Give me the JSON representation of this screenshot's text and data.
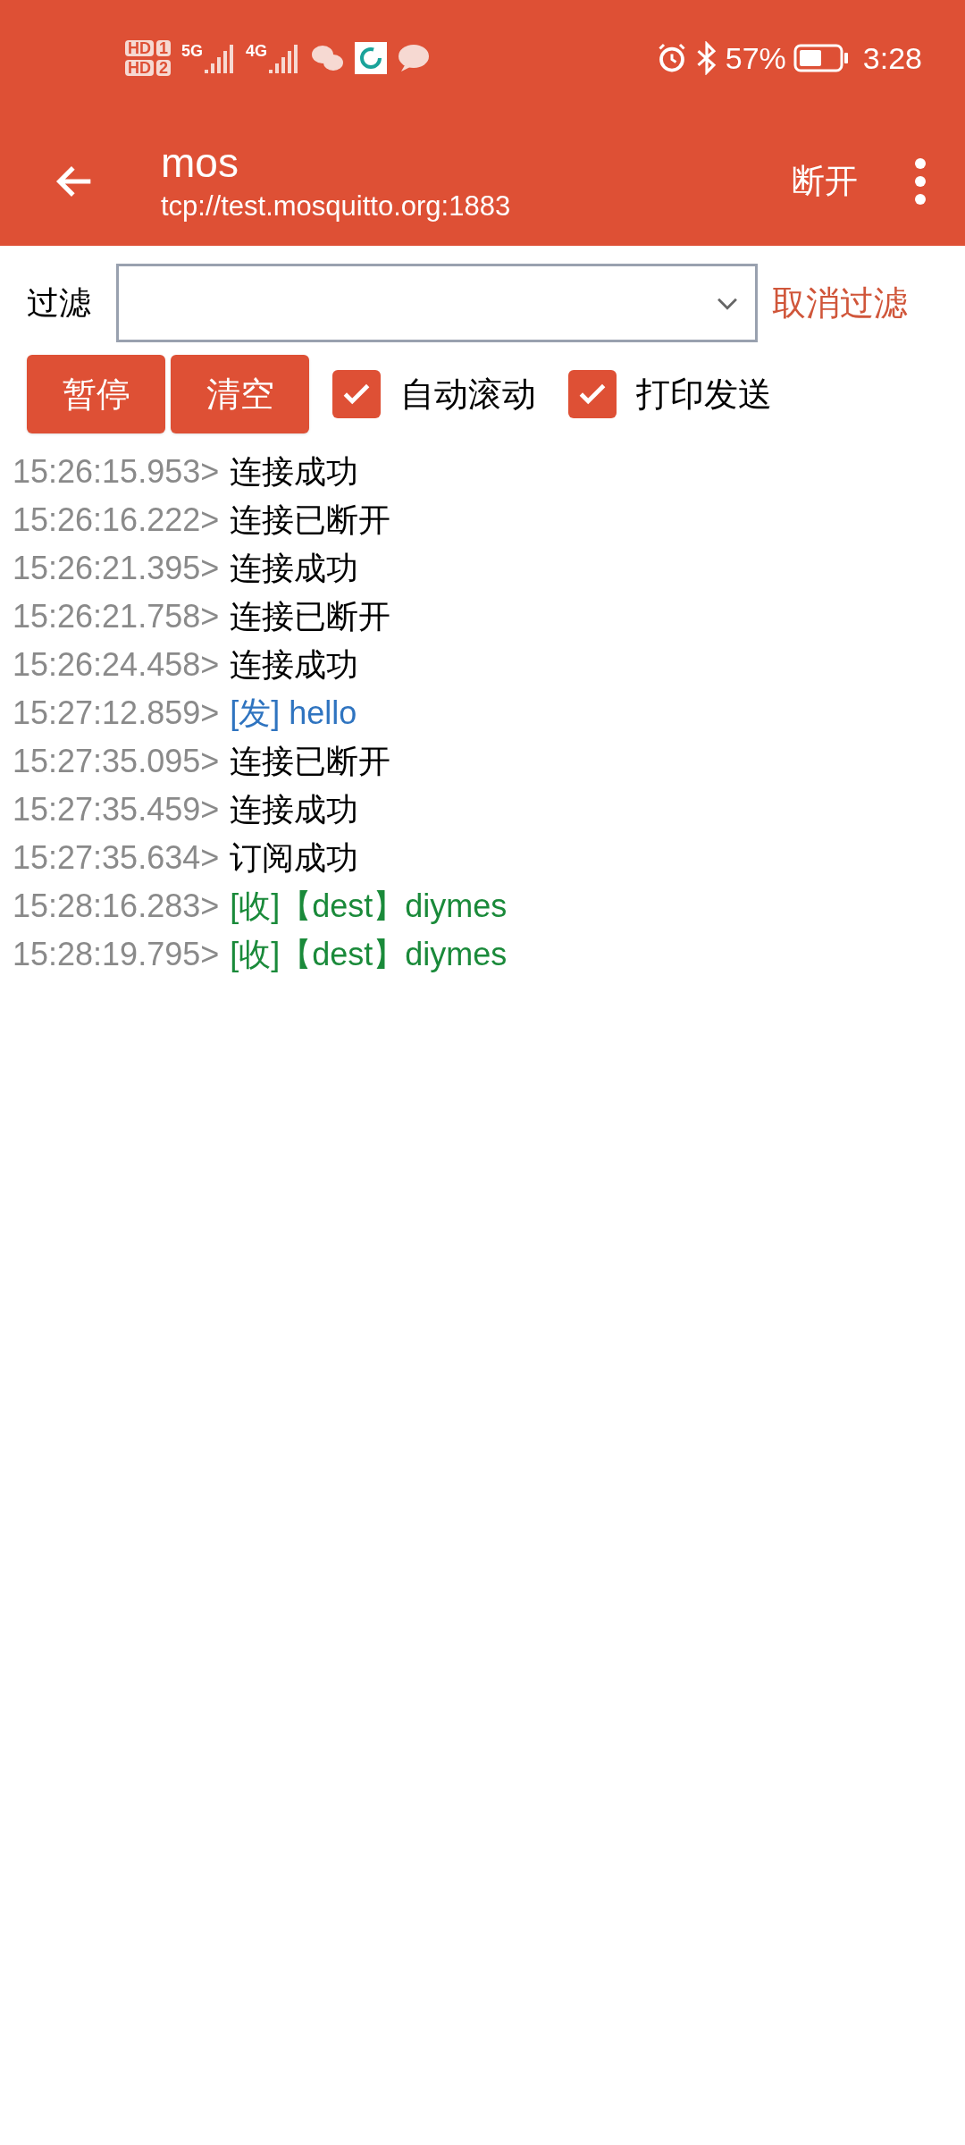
{
  "status_bar": {
    "sims": [
      {
        "hd": "HD",
        "slot": "1"
      },
      {
        "hd": "HD",
        "slot": "2"
      }
    ],
    "networks": [
      "5G",
      "4G"
    ],
    "battery": "57%",
    "time": "3:28"
  },
  "app_bar": {
    "title": "mos",
    "subtitle": "tcp://test.mosquitto.org:1883",
    "action": "断开"
  },
  "filter": {
    "label": "过滤",
    "cancel": "取消过滤"
  },
  "buttons": [
    "暂停",
    "清空"
  ],
  "checkboxes": [
    {
      "label": "自动滚动",
      "checked": true
    },
    {
      "label": "打印发送",
      "checked": true
    }
  ],
  "log": [
    {
      "time": "15:26:15.953>",
      "text": "连接成功",
      "kind": "info"
    },
    {
      "time": "15:26:16.222>",
      "text": "连接已断开",
      "kind": "info"
    },
    {
      "time": "15:26:21.395>",
      "text": "连接成功",
      "kind": "info"
    },
    {
      "time": "15:26:21.758>",
      "text": "连接已断开",
      "kind": "info"
    },
    {
      "time": "15:26:24.458>",
      "text": "连接成功",
      "kind": "info"
    },
    {
      "time": "15:27:12.859>",
      "text": "[发] hello",
      "kind": "sent"
    },
    {
      "time": "15:27:35.095>",
      "text": "连接已断开",
      "kind": "info"
    },
    {
      "time": "15:27:35.459>",
      "text": "连接成功",
      "kind": "info"
    },
    {
      "time": "15:27:35.634>",
      "text": "订阅成功",
      "kind": "info"
    },
    {
      "time": "15:28:16.283>",
      "text": "[收]【dest】diymes",
      "kind": "received"
    },
    {
      "time": "15:28:19.795>",
      "text": "[收]【dest】diymes",
      "kind": "received"
    }
  ]
}
